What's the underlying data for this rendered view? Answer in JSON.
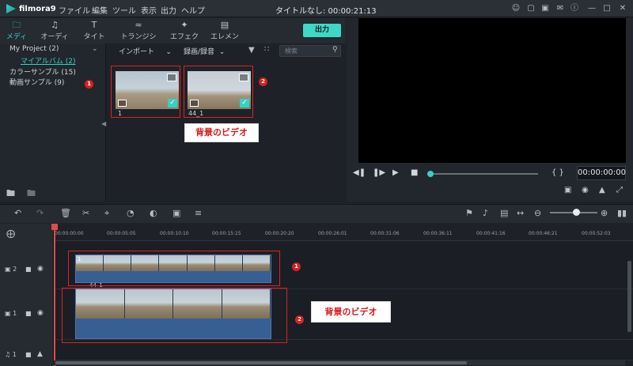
{
  "app": {
    "logo_text": "filmora9",
    "window_title": "タイトルなし: 00:00:21:13"
  },
  "menu": [
    "ファイル",
    "編集",
    "ツール",
    "表示",
    "出力",
    "ヘルプ"
  ],
  "media_tabs": [
    {
      "label": "メディア",
      "icon": "folder-icon",
      "active": true
    },
    {
      "label": "オーディオ",
      "icon": "music-note-icon",
      "active": false
    },
    {
      "label": "タイトル",
      "icon": "title-icon",
      "active": false
    },
    {
      "label": "トランジション",
      "icon": "transition-icon",
      "active": false
    },
    {
      "label": "エフェクト",
      "icon": "effect-icon",
      "active": false
    },
    {
      "label": "エレメント",
      "icon": "element-icon",
      "active": false
    }
  ],
  "export_label": "出力",
  "library": {
    "items": [
      {
        "label": "My Project (2)"
      },
      {
        "label": "マイアルバム (2)",
        "selected": true
      },
      {
        "label": "カラーサンプル (15)"
      },
      {
        "label": "動画サンプル (9)"
      }
    ]
  },
  "media_toolbar": {
    "import_label": "インポート",
    "record_label": "録画/録音",
    "search_placeholder": "検索"
  },
  "media_items": [
    {
      "label": "1"
    },
    {
      "label": "44_1"
    }
  ],
  "callouts": {
    "badge1": "1",
    "badge2": "2",
    "text": "背景のビデオ"
  },
  "preview": {
    "timecode": "00:00:00:00"
  },
  "ruler_ticks": [
    "00:00:00:00",
    "00:00:05:05",
    "00:00:10:10",
    "00:00:15:15",
    "00:00:20:20",
    "00:00:26:01",
    "00:00:31:06",
    "00:00:36:11",
    "00:00:41:16",
    "00:00:46:21",
    "00:00:52:03"
  ],
  "tracks": [
    {
      "label": "2",
      "type": "video",
      "clip_label": "1"
    },
    {
      "label": "1",
      "type": "video",
      "clip_label": "44_1"
    },
    {
      "label": "1",
      "type": "audio"
    }
  ],
  "colors": {
    "accent": "#38d0c5",
    "callout_red": "#d91f1f",
    "clip_blue": "#365f94"
  }
}
